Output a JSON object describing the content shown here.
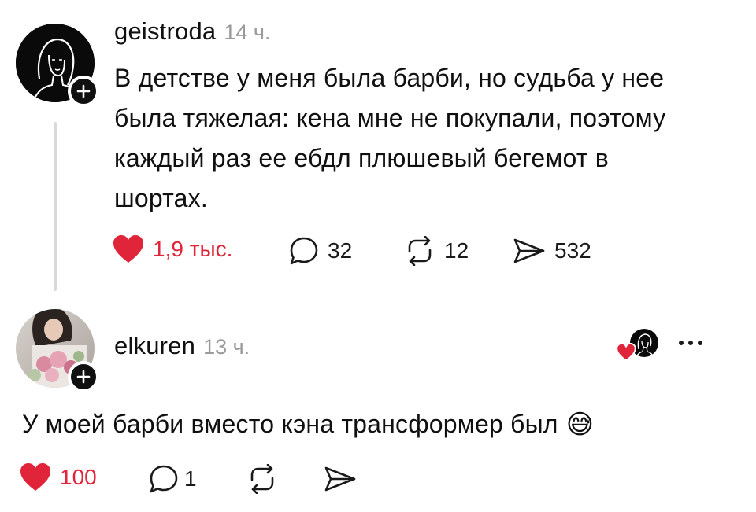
{
  "post": {
    "username": "geistroda",
    "time": "14 ч.",
    "text_lines": [
      "В детстве у меня была барби, но судьба у нее",
      "была тяжелая: кена мне не покупали, поэтому",
      "каждый раз ее ебдл плюшевый бегемот в",
      "шортах."
    ],
    "likes": "1,9 тыс.",
    "comments": "32",
    "reposts": "12",
    "shares": "532",
    "liked": true
  },
  "reply": {
    "username": "elkuren",
    "time": "13 ч.",
    "text": "У моей барби вместо кэна трансформер был",
    "emoji": "😅",
    "likes": "100",
    "comments": "1",
    "liked": true
  },
  "colors": {
    "like_red": "#e0243a",
    "muted_gray": "#9a9a9a",
    "text": "#101010"
  }
}
